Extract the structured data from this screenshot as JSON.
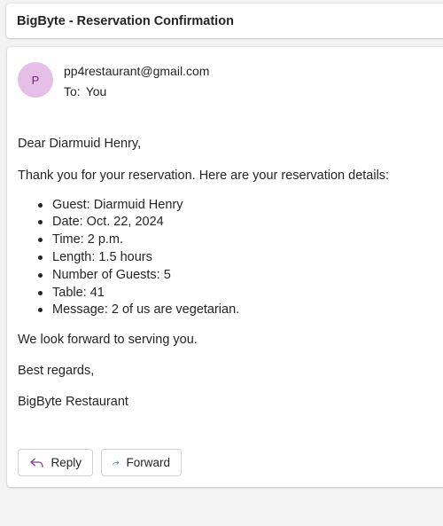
{
  "subject": "BigByte - Reservation Confirmation",
  "sender": {
    "avatar_initial": "P",
    "email": "pp4restaurant@gmail.com",
    "to_label": "To:",
    "to_value": "You"
  },
  "body": {
    "greeting": "Dear Diarmuid Henry,",
    "intro": "Thank you for your reservation. Here are your reservation details:",
    "details": [
      "Guest: Diarmuid Henry",
      "Date: Oct. 22, 2024",
      "Time: 2 p.m.",
      "Length: 1.5 hours",
      "Number of Guests: 5",
      "Table: 41",
      "Message: 2 of us are vegetarian."
    ],
    "closing": "We look forward to serving you.",
    "regards": "Best regards,",
    "signature": "BigByte Restaurant"
  },
  "actions": {
    "reply_label": "Reply",
    "forward_label": "Forward"
  },
  "colors": {
    "avatar_bg": "#e6bfe9",
    "avatar_text": "#6b2d72",
    "reply_icon": "#8a3a96",
    "forward_icon": "#2a6fb8"
  },
  "icons": {
    "reply": "reply-arrow-icon",
    "forward": "forward-arrow-icon"
  }
}
